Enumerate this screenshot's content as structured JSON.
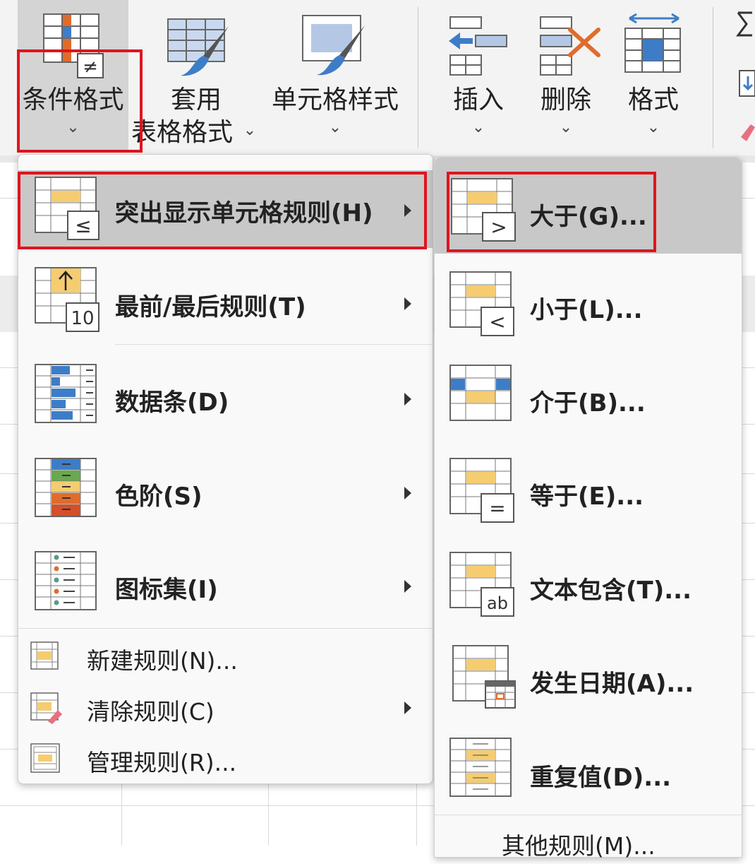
{
  "ribbon": {
    "conditional_format": "条件格式",
    "table_format_line1": "套用",
    "table_format_line2": "表格格式",
    "cell_styles": "单元格样式",
    "insert": "插入",
    "delete": "删除",
    "format": "格式",
    "chevron": "⌄",
    "not_equal": "≠"
  },
  "main_menu": {
    "items": [
      {
        "label": "突出显示单元格规则(H)",
        "accel": "H",
        "highlighted": true
      },
      {
        "label": "最前/最后规则(T)",
        "accel": "T",
        "icon_text": "10"
      },
      {
        "label": "数据条(D)",
        "accel": "D"
      },
      {
        "label": "色阶(S)",
        "accel": "S"
      },
      {
        "label": "图标集(I)",
        "accel": "I"
      },
      {
        "label": "新建规则(N)...",
        "accel": "N"
      },
      {
        "label": "清除规则(C)",
        "accel": "C"
      },
      {
        "label": "管理规则(R)...",
        "accel": "R"
      }
    ],
    "le_symbol": "≤"
  },
  "sub_menu": {
    "items": [
      {
        "label": "大于(G)...",
        "accel": "G",
        "symbol": ">",
        "highlighted": true
      },
      {
        "label": "小于(L)...",
        "accel": "L",
        "symbol": "<"
      },
      {
        "label": "介于(B)...",
        "accel": "B"
      },
      {
        "label": "等于(E)...",
        "accel": "E",
        "symbol": "="
      },
      {
        "label": "文本包含(T)...",
        "accel": "T",
        "symbol": "ab"
      },
      {
        "label": "发生日期(A)...",
        "accel": "A"
      },
      {
        "label": "重复值(D)...",
        "accel": "D"
      },
      {
        "label": "其他规则(M)...",
        "accel": "M"
      }
    ]
  },
  "colors": {
    "highlight_red": "#e0141e",
    "accent_blue": "#3d7dc8",
    "yellow": "#f5cc70",
    "orange": "#e06c2c",
    "green": "#6aa84f"
  }
}
